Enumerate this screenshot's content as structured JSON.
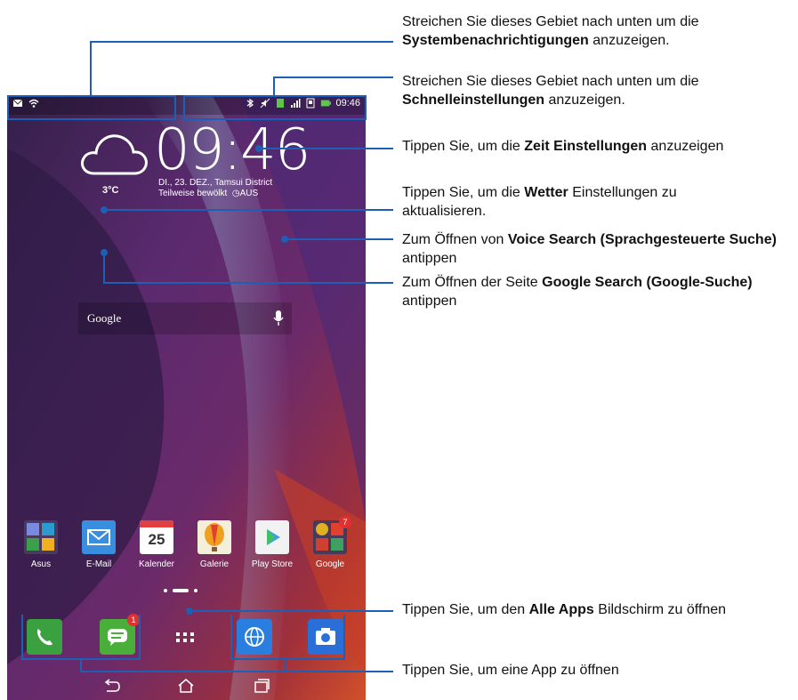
{
  "status_bar": {
    "time": "09:46",
    "left_icons": [
      "mail-icon",
      "wifi-icon"
    ],
    "right_icons": [
      "bluetooth-icon",
      "mute-icon",
      "sim-icon",
      "signal-icon",
      "alarm-icon",
      "battery-icon"
    ]
  },
  "clock_widget": {
    "time": "09:46",
    "date_location": "DI., 23. DEZ., Tamsui District",
    "weather_text": "Teilweise bewölkt",
    "alarm_text": "AUS",
    "temperature": "3°C"
  },
  "google_search": {
    "label": "Google"
  },
  "apps": [
    {
      "label": "Asus"
    },
    {
      "label": "E-Mail"
    },
    {
      "label": "Kalender",
      "day": "25"
    },
    {
      "label": "Galerie"
    },
    {
      "label": "Play Store"
    },
    {
      "label": "Google",
      "badge": "7"
    }
  ],
  "dock": {
    "items": [
      "phone-icon",
      "messages-icon",
      "all-apps-icon",
      "browser-icon",
      "camera-icon"
    ],
    "messages_badge": "1"
  },
  "callouts": [
    {
      "pre": "Streichen Sie dieses Gebiet nach unten um die",
      "bold": "Systembenachrichtigungen",
      "post": "anzuzeigen."
    },
    {
      "pre": "Streichen Sie dieses Gebiet nach unten um die",
      "bold": "Schnelleinstellungen",
      "post": "anzuzeigen."
    },
    {
      "pre": "Tippen Sie, um die",
      "bold": "Zeit Einstellungen",
      "post": "anzuzeigen"
    },
    {
      "pre": "Tippen Sie, um die",
      "bold": "Wetter",
      "post": "Einstellungen zu aktualisieren."
    },
    {
      "pre": "Zum Öffnen von",
      "bold": "Voice Search (Sprachgesteuerte Suche)",
      "post": "antippen"
    },
    {
      "pre": "Zum Öffnen der Seite",
      "bold": "Google Search (Google-Suche)",
      "post": "antippen"
    },
    {
      "pre": "Tippen Sie, um den",
      "bold": "Alle Apps",
      "post": "Bildschirm zu öffnen"
    },
    {
      "pre": "Tippen Sie, um eine App zu öffnen",
      "bold": "",
      "post": ""
    }
  ],
  "colors": {
    "callout_line": "#1e5fb5"
  }
}
